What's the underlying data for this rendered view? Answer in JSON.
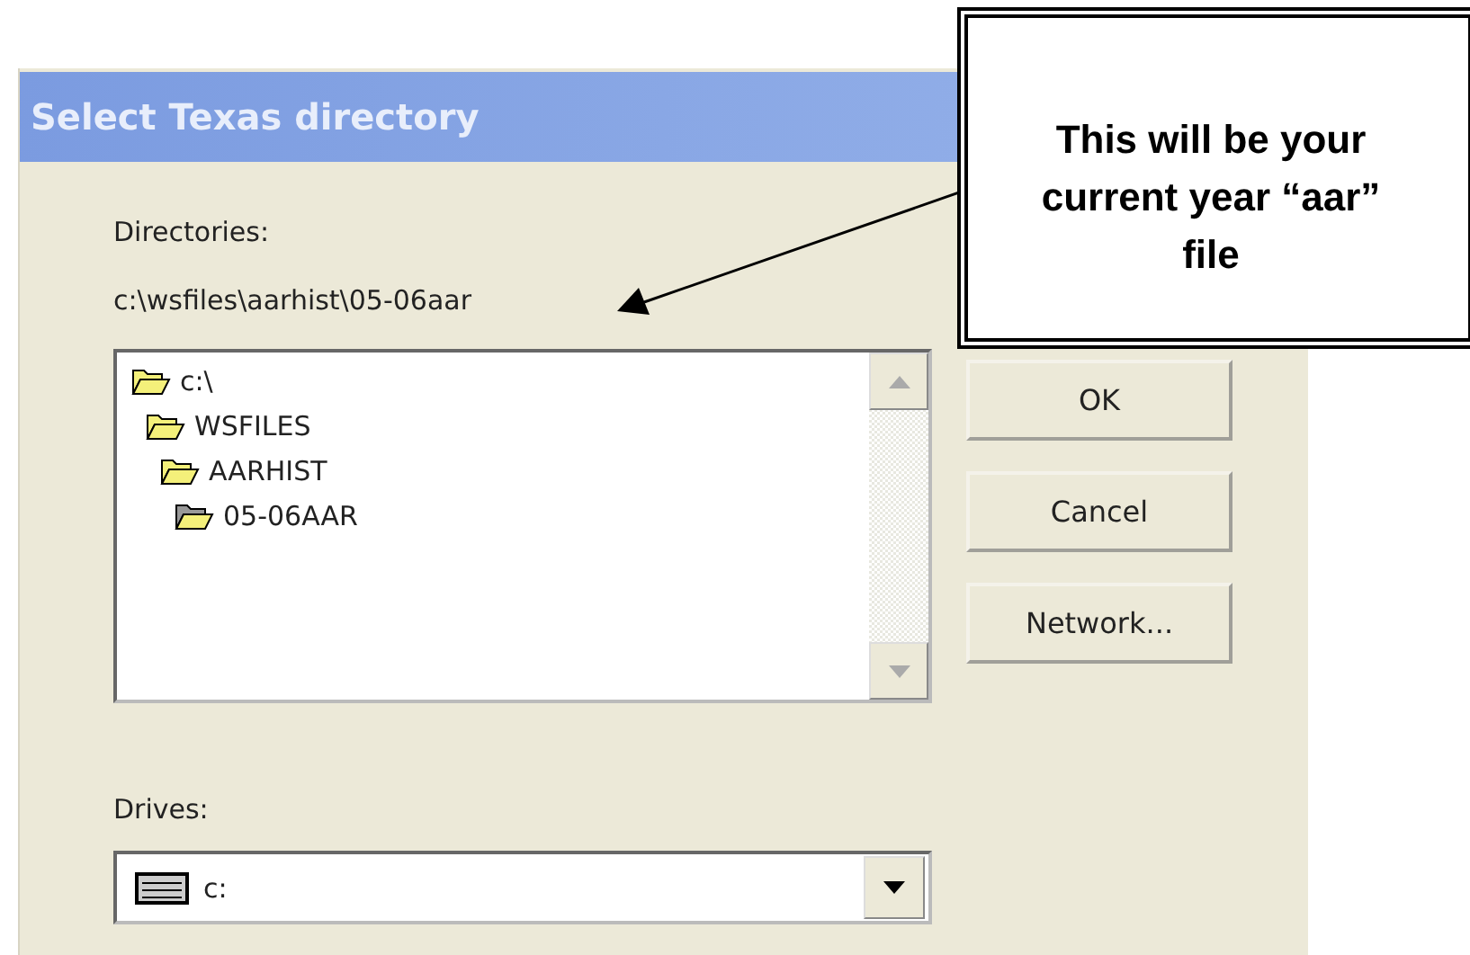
{
  "window": {
    "title": "Select Texas directory"
  },
  "directories": {
    "label": "Directories:",
    "path": "c:\\wsfiles\\aarhist\\05-06aar",
    "tree": [
      {
        "label": "c:\\",
        "children": [
          {
            "label": "WSFILES",
            "children": [
              {
                "label": "AARHIST",
                "children": [
                  {
                    "label": "05-06AAR"
                  }
                ]
              }
            ]
          }
        ]
      }
    ]
  },
  "buttons": [
    "OK",
    "Cancel",
    "Network..."
  ],
  "drives": {
    "label": "Drives:",
    "value": "c:"
  },
  "callout": {
    "text": "This will be your current year “aar” file"
  }
}
